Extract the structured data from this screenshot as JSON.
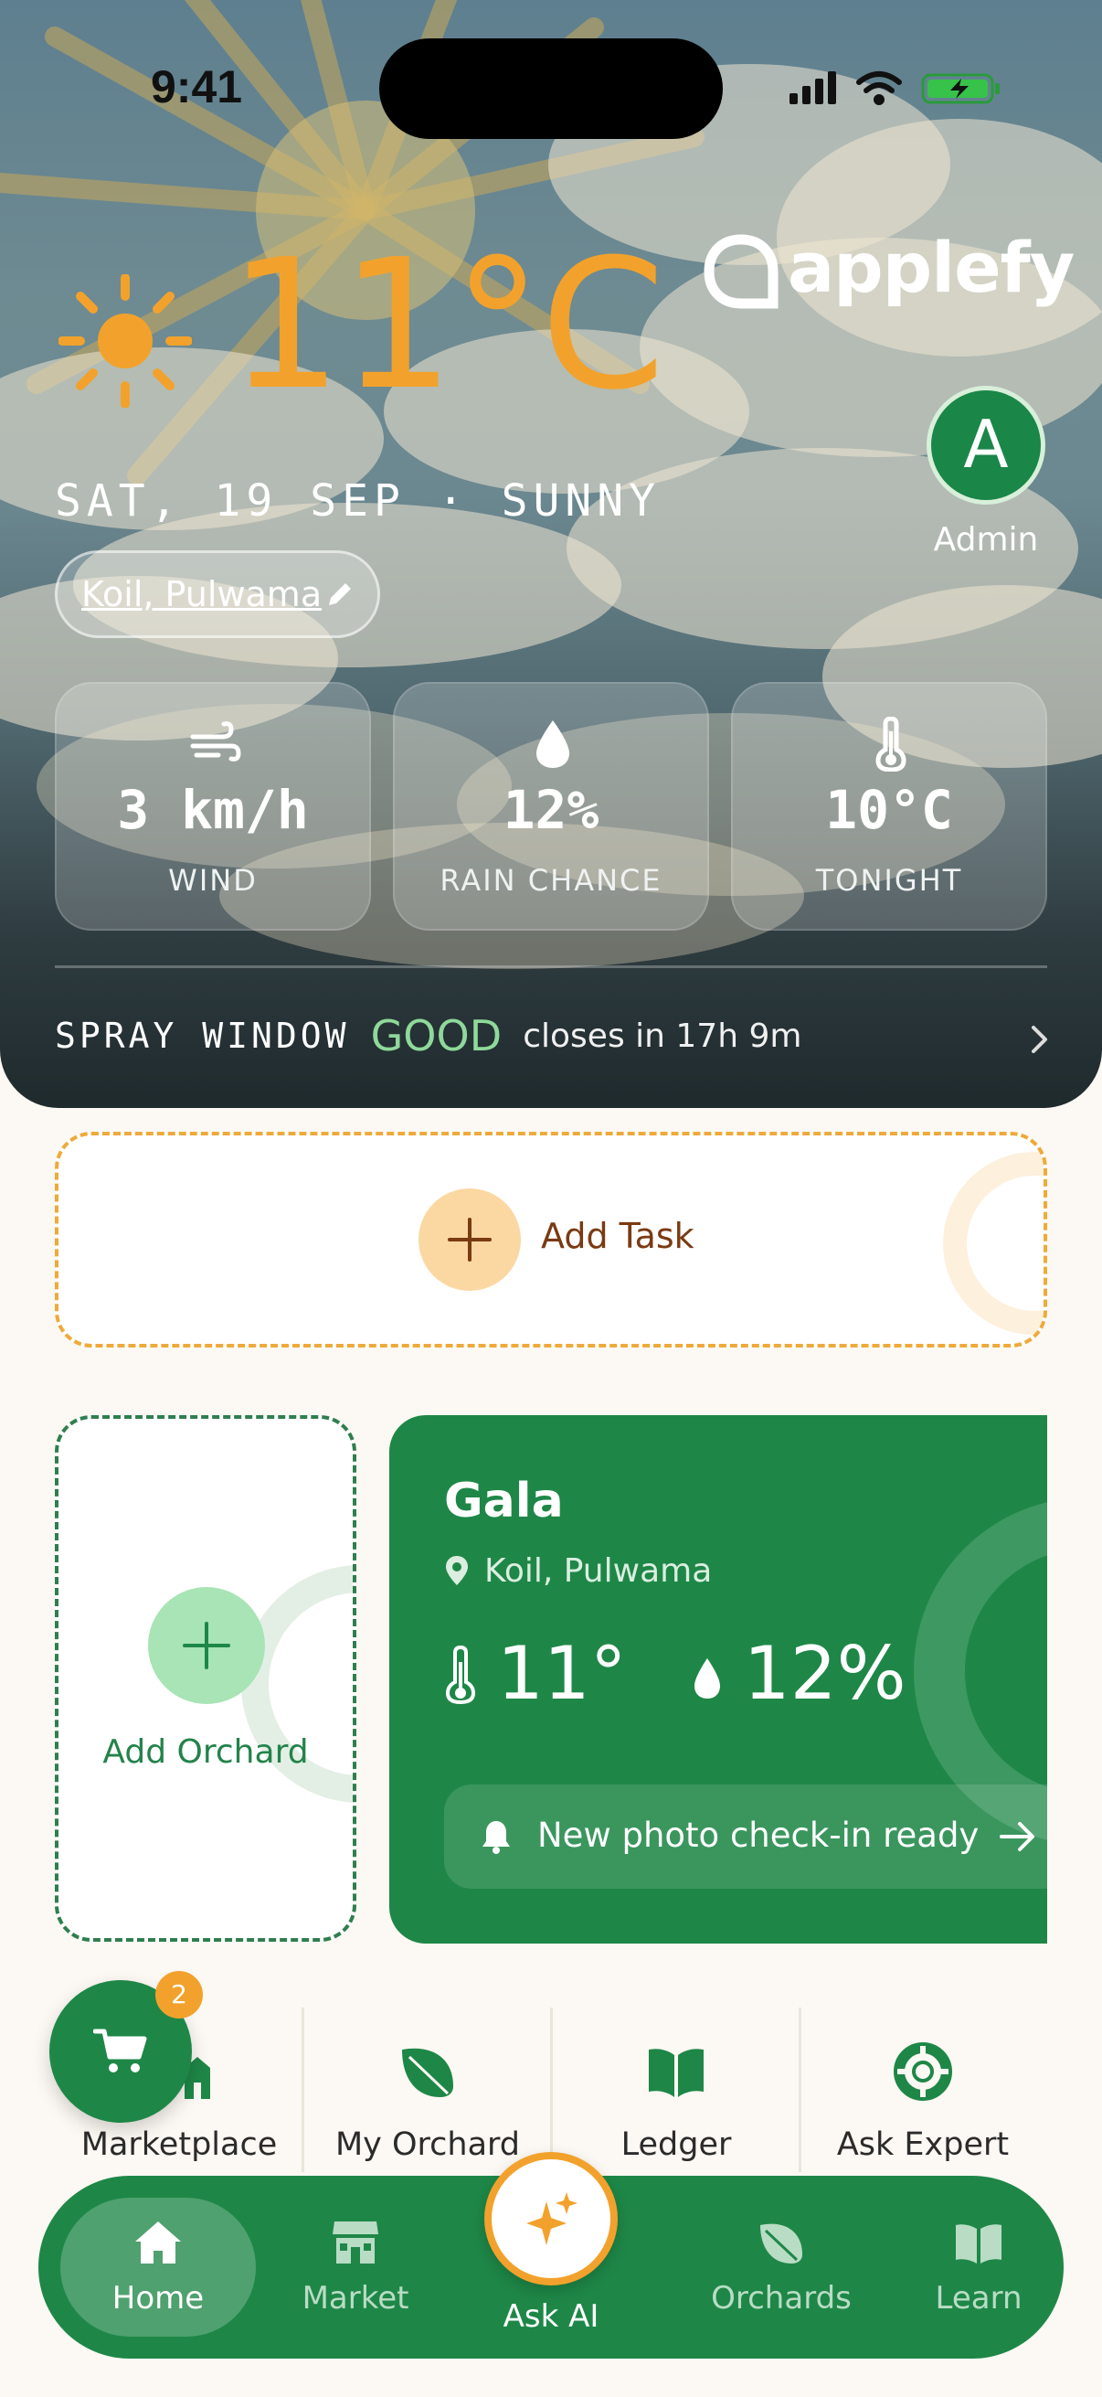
{
  "status_bar": {
    "time": "9:41"
  },
  "weather": {
    "temperature": "11°C",
    "date_line": "SAT, 19 SEP · SUNNY",
    "location": "Koil, Pulwama",
    "icon": "sun-icon",
    "stats": [
      {
        "value": "3 km/h",
        "label": "WIND",
        "icon": "wind-icon"
      },
      {
        "value": "12%",
        "label": "RAIN CHANCE",
        "icon": "droplet-icon"
      },
      {
        "value": "10°C",
        "label": "TONIGHT",
        "icon": "thermometer-icon"
      }
    ],
    "spray": {
      "label": "SPRAY WINDOW",
      "status": "GOOD",
      "detail": "closes in 17h 9m"
    }
  },
  "brand": {
    "name": "applefy"
  },
  "user": {
    "initial": "A",
    "role": "Admin"
  },
  "tasks": {
    "add_label": "Add Task"
  },
  "orchards": {
    "add_label": "Add Orchard",
    "cards": [
      {
        "name": "Gala",
        "location": "Koil, Pulwama",
        "temperature": "11°",
        "rain": "12%",
        "notification": "New photo check-in ready"
      }
    ]
  },
  "quick_nav": [
    {
      "label": "Marketplace",
      "icon": "store-icon"
    },
    {
      "label": "My Orchard",
      "icon": "leaf-icon"
    },
    {
      "label": "Ledger",
      "icon": "book-icon"
    },
    {
      "label": "Ask Expert",
      "icon": "lifebuoy-icon"
    }
  ],
  "cart": {
    "badge": "2"
  },
  "tab_bar": {
    "tabs": [
      {
        "label": "Home",
        "icon": "home-icon",
        "active": true
      },
      {
        "label": "Market",
        "icon": "store-icon",
        "active": false
      },
      {
        "label": "Ask AI",
        "icon": "sparkles-icon",
        "active": false
      },
      {
        "label": "Orchards",
        "icon": "leaf-icon",
        "active": false
      },
      {
        "label": "Learn",
        "icon": "book-icon",
        "active": false
      }
    ]
  },
  "colors": {
    "brand_green": "#1e8747",
    "accent_orange": "#f2a22c",
    "spray_good": "#8fd99a",
    "background": "#fcf8f3"
  }
}
